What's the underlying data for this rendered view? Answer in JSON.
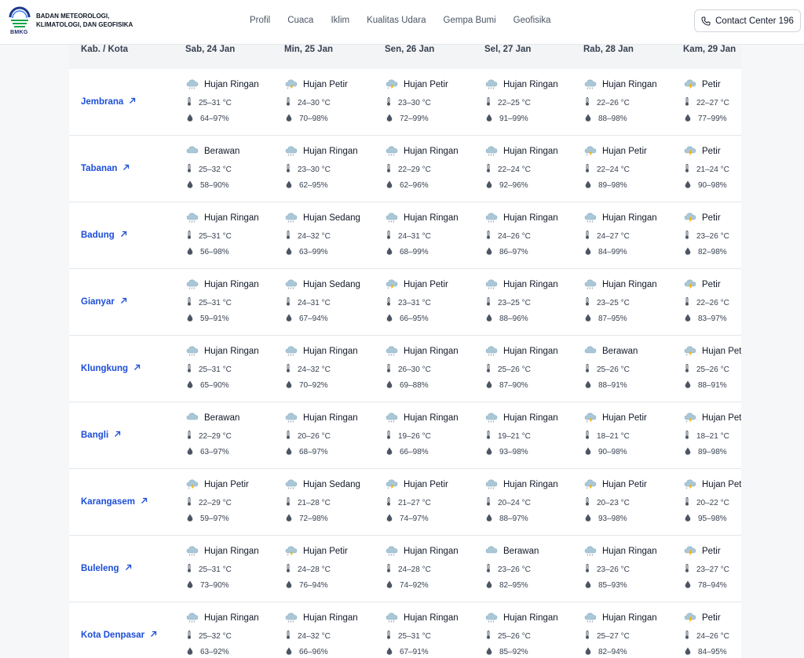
{
  "header": {
    "org_name": "BADAN METEOROLOGI, KLIMATOLOGI, DAN GEOFISIKA",
    "logo_abbr": "BMKG",
    "nav": [
      "Profil",
      "Cuaca",
      "Iklim",
      "Kualitas Udara",
      "Gempa Bumi",
      "Geofisika"
    ],
    "contact_label": "Contact Center 196"
  },
  "table": {
    "columns": [
      "Kab. / Kota",
      "Sab, 24 Jan",
      "Min, 25 Jan",
      "Sen, 26 Jan",
      "Sel, 27 Jan",
      "Rab, 28 Jan",
      "Kam, 29 Jan"
    ],
    "rows": [
      {
        "city": "Jembrana",
        "days": [
          {
            "cond": "Hujan Ringan",
            "icon": "light-rain",
            "temp": "25–31 °C",
            "hum": "64–97%"
          },
          {
            "cond": "Hujan Petir",
            "icon": "thunderstorm",
            "temp": "24–30 °C",
            "hum": "70–98%"
          },
          {
            "cond": "Hujan Petir",
            "icon": "thunderstorm",
            "temp": "23–30 °C",
            "hum": "72–99%"
          },
          {
            "cond": "Hujan Ringan",
            "icon": "light-rain",
            "temp": "22–25 °C",
            "hum": "91–99%"
          },
          {
            "cond": "Hujan Ringan",
            "icon": "light-rain",
            "temp": "22–26 °C",
            "hum": "88–98%"
          },
          {
            "cond": "Petir",
            "icon": "lightning",
            "temp": "22–27 °C",
            "hum": "77–99%"
          }
        ]
      },
      {
        "city": "Tabanan",
        "days": [
          {
            "cond": "Berawan",
            "icon": "cloudy",
            "temp": "25–32 °C",
            "hum": "58–90%"
          },
          {
            "cond": "Hujan Ringan",
            "icon": "light-rain",
            "temp": "23–30 °C",
            "hum": "62–95%"
          },
          {
            "cond": "Hujan Ringan",
            "icon": "light-rain",
            "temp": "22–29 °C",
            "hum": "62–96%"
          },
          {
            "cond": "Hujan Ringan",
            "icon": "light-rain",
            "temp": "22–24 °C",
            "hum": "92–96%"
          },
          {
            "cond": "Hujan Petir",
            "icon": "thunderstorm",
            "temp": "22–24 °C",
            "hum": "89–98%"
          },
          {
            "cond": "Petir",
            "icon": "lightning",
            "temp": "21–24 °C",
            "hum": "90–98%"
          }
        ]
      },
      {
        "city": "Badung",
        "days": [
          {
            "cond": "Hujan Ringan",
            "icon": "light-rain",
            "temp": "25–31 °C",
            "hum": "56–98%"
          },
          {
            "cond": "Hujan Sedang",
            "icon": "moderate-rain",
            "temp": "24–32 °C",
            "hum": "63–99%"
          },
          {
            "cond": "Hujan Ringan",
            "icon": "light-rain",
            "temp": "24–31 °C",
            "hum": "68–99%"
          },
          {
            "cond": "Hujan Ringan",
            "icon": "light-rain",
            "temp": "24–26 °C",
            "hum": "86–97%"
          },
          {
            "cond": "Hujan Ringan",
            "icon": "light-rain",
            "temp": "24–27 °C",
            "hum": "84–99%"
          },
          {
            "cond": "Petir",
            "icon": "lightning",
            "temp": "23–26 °C",
            "hum": "82–98%"
          }
        ]
      },
      {
        "city": "Gianyar",
        "days": [
          {
            "cond": "Hujan Ringan",
            "icon": "light-rain",
            "temp": "25–31 °C",
            "hum": "59–91%"
          },
          {
            "cond": "Hujan Sedang",
            "icon": "moderate-rain",
            "temp": "24–31 °C",
            "hum": "67–94%"
          },
          {
            "cond": "Hujan Petir",
            "icon": "thunderstorm",
            "temp": "23–31 °C",
            "hum": "66–95%"
          },
          {
            "cond": "Hujan Ringan",
            "icon": "light-rain",
            "temp": "23–25 °C",
            "hum": "88–96%"
          },
          {
            "cond": "Hujan Ringan",
            "icon": "light-rain",
            "temp": "23–25 °C",
            "hum": "87–95%"
          },
          {
            "cond": "Petir",
            "icon": "lightning",
            "temp": "22–26 °C",
            "hum": "83–97%"
          }
        ]
      },
      {
        "city": "Klungkung",
        "days": [
          {
            "cond": "Hujan Ringan",
            "icon": "light-rain",
            "temp": "25–31 °C",
            "hum": "65–90%"
          },
          {
            "cond": "Hujan Ringan",
            "icon": "light-rain",
            "temp": "24–32 °C",
            "hum": "70–92%"
          },
          {
            "cond": "Hujan Ringan",
            "icon": "light-rain",
            "temp": "26–30 °C",
            "hum": "69–88%"
          },
          {
            "cond": "Hujan Ringan",
            "icon": "light-rain",
            "temp": "25–26 °C",
            "hum": "87–90%"
          },
          {
            "cond": "Berawan",
            "icon": "cloudy",
            "temp": "25–26 °C",
            "hum": "88–91%"
          },
          {
            "cond": "Hujan Pet",
            "icon": "thunderstorm",
            "temp": "25–26 °C",
            "hum": "88–91%"
          }
        ]
      },
      {
        "city": "Bangli",
        "days": [
          {
            "cond": "Berawan",
            "icon": "cloudy",
            "temp": "22–29 °C",
            "hum": "63–97%"
          },
          {
            "cond": "Hujan Ringan",
            "icon": "light-rain",
            "temp": "20–26 °C",
            "hum": "68–97%"
          },
          {
            "cond": "Hujan Ringan",
            "icon": "light-rain",
            "temp": "19–26 °C",
            "hum": "66–98%"
          },
          {
            "cond": "Hujan Ringan",
            "icon": "light-rain",
            "temp": "19–21 °C",
            "hum": "93–98%"
          },
          {
            "cond": "Hujan Petir",
            "icon": "thunderstorm",
            "temp": "18–21 °C",
            "hum": "90–98%"
          },
          {
            "cond": "Hujan Pet",
            "icon": "thunderstorm",
            "temp": "18–21 °C",
            "hum": "89–98%"
          }
        ]
      },
      {
        "city": "Karangasem",
        "days": [
          {
            "cond": "Hujan Petir",
            "icon": "thunderstorm",
            "temp": "22–29 °C",
            "hum": "59–97%"
          },
          {
            "cond": "Hujan Sedang",
            "icon": "moderate-rain",
            "temp": "21–28 °C",
            "hum": "72–98%"
          },
          {
            "cond": "Hujan Petir",
            "icon": "thunderstorm",
            "temp": "21–27 °C",
            "hum": "74–97%"
          },
          {
            "cond": "Hujan Ringan",
            "icon": "light-rain",
            "temp": "20–24 °C",
            "hum": "88–97%"
          },
          {
            "cond": "Hujan Petir",
            "icon": "thunderstorm",
            "temp": "20–23 °C",
            "hum": "93–98%"
          },
          {
            "cond": "Hujan Pet",
            "icon": "thunderstorm",
            "temp": "20–22 °C",
            "hum": "95–98%"
          }
        ]
      },
      {
        "city": "Buleleng",
        "days": [
          {
            "cond": "Hujan Ringan",
            "icon": "light-rain",
            "temp": "25–31 °C",
            "hum": "73–90%"
          },
          {
            "cond": "Hujan Petir",
            "icon": "thunderstorm",
            "temp": "24–28 °C",
            "hum": "76–94%"
          },
          {
            "cond": "Hujan Ringan",
            "icon": "light-rain",
            "temp": "24–28 °C",
            "hum": "74–92%"
          },
          {
            "cond": "Berawan",
            "icon": "cloudy",
            "temp": "23–26 °C",
            "hum": "82–95%"
          },
          {
            "cond": "Hujan Ringan",
            "icon": "light-rain",
            "temp": "23–26 °C",
            "hum": "85–93%"
          },
          {
            "cond": "Petir",
            "icon": "lightning",
            "temp": "23–27 °C",
            "hum": "78–94%"
          }
        ]
      },
      {
        "city": "Kota Denpasar",
        "days": [
          {
            "cond": "Hujan Ringan",
            "icon": "light-rain",
            "temp": "25–32 °C",
            "hum": "63–92%"
          },
          {
            "cond": "Hujan Ringan",
            "icon": "light-rain",
            "temp": "24–32 °C",
            "hum": "66–96%"
          },
          {
            "cond": "Hujan Ringan",
            "icon": "light-rain",
            "temp": "25–31 °C",
            "hum": "67–91%"
          },
          {
            "cond": "Hujan Ringan",
            "icon": "light-rain",
            "temp": "25–26 °C",
            "hum": "85–92%"
          },
          {
            "cond": "Hujan Ringan",
            "icon": "light-rain",
            "temp": "25–27 °C",
            "hum": "82–94%"
          },
          {
            "cond": "Petir",
            "icon": "lightning",
            "temp": "24–26 °C",
            "hum": "84–95%"
          }
        ]
      }
    ]
  },
  "colors": {
    "link": "#1d4ed8",
    "header_bg": "#f3f4f6",
    "cloud": "#a9c7d6",
    "rain": "#9ca3af",
    "bolt": "#f5b100",
    "icon_dark": "#4b5563"
  }
}
